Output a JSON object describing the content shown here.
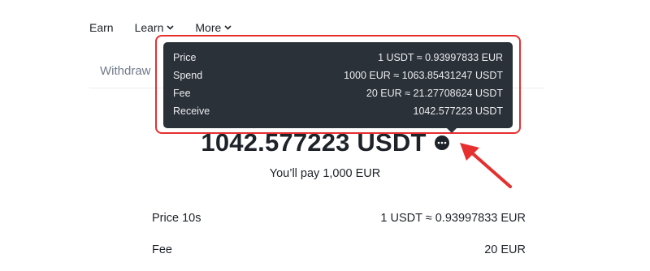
{
  "nav": {
    "items": [
      {
        "label": "Earn",
        "has_dropdown": false
      },
      {
        "label": "Learn",
        "has_dropdown": true
      },
      {
        "label": "More",
        "has_dropdown": true
      }
    ]
  },
  "tabs": {
    "withdraw_label": "Withdraw"
  },
  "tooltip": {
    "rows": [
      {
        "label": "Price",
        "value": "1 USDT ≈ 0.93997833 EUR"
      },
      {
        "label": "Spend",
        "value": "1000 EUR ≈ 1063.85431247 USDT"
      },
      {
        "label": "Fee",
        "value": "20 EUR ≈ 21.27708624 USDT"
      },
      {
        "label": "Receive",
        "value": "1042.577223 USDT"
      }
    ]
  },
  "summary": {
    "amount": "1042.577223 USDT",
    "pay_text": "You’ll pay 1,000 EUR"
  },
  "details": [
    {
      "label": "Price 10s",
      "value": "1 USDT ≈ 0.93997833 EUR"
    },
    {
      "label": "Fee",
      "value": "20 EUR"
    }
  ],
  "colors": {
    "annotation_red": "#e5302f",
    "tooltip_bg": "#2b3139",
    "text_primary": "#1e2329",
    "text_secondary": "#707a8a"
  },
  "icons": {
    "more_button": "ellipsis-icon",
    "dropdown": "chevron-down-icon",
    "annotation": "red-arrow-icon"
  }
}
